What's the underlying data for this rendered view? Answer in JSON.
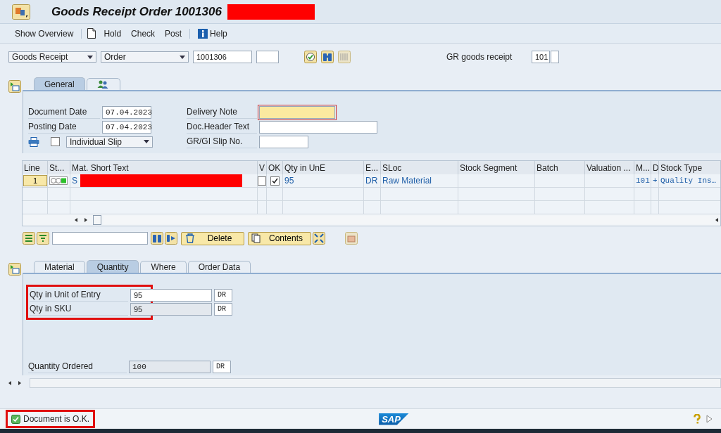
{
  "window": {
    "title": "Goods Receipt Order 1001306"
  },
  "toolbar": [
    {
      "kind": "text",
      "label": "Show Overview"
    },
    {
      "kind": "document"
    },
    {
      "kind": "text",
      "label": "Hold"
    },
    {
      "kind": "text",
      "label": "Check"
    },
    {
      "kind": "text",
      "label": "Post"
    },
    {
      "kind": "info",
      "label": "Help"
    }
  ],
  "selection": {
    "action": "Goods Receipt",
    "reference": "Order",
    "number": "1001306",
    "movement_label": "GR goods receipt",
    "movement_type": "101"
  },
  "header_tabs": [
    {
      "kind": "text",
      "label": "General",
      "selected": true
    },
    {
      "kind": "persons",
      "selected": false
    }
  ],
  "general": {
    "left_fields": [
      {
        "label": "Document Date",
        "value": "07.04.2023"
      },
      {
        "label": "Posting Date",
        "value": "07.04.2023"
      }
    ],
    "print_checked": false,
    "print_version": "Individual Slip",
    "right_fields": [
      {
        "label": "Delivery Note",
        "focused": true
      },
      {
        "label": "Doc.Header Text",
        "focused": false
      },
      {
        "label": "GR/GI Slip No.",
        "focused": false
      }
    ]
  },
  "table": {
    "columns": [
      "Line",
      "St...",
      "Mat. Short Text",
      "V",
      "OK",
      "Qty in UnE",
      "E...",
      "SLoc",
      "Stock Segment",
      "Batch",
      "Valuation ...",
      "M...",
      "D",
      "Stock Type"
    ],
    "rows": [
      {
        "line": "1",
        "mat_short_text": "S",
        "v_checked": false,
        "ok_checked": true,
        "qty": "95",
        "unit": "DR",
        "sloc": "Raw Material",
        "movement": "101",
        "d": "+",
        "stock_type": "Quality Ins…"
      }
    ]
  },
  "table_toolbar": {
    "delete": "Delete",
    "contents": "Contents"
  },
  "detail_tabs": [
    {
      "label": "Material",
      "selected": false
    },
    {
      "label": "Quantity",
      "selected": true
    },
    {
      "label": "Where",
      "selected": false
    },
    {
      "label": "Order Data",
      "selected": false
    }
  ],
  "quantity": {
    "highlighted": true,
    "fields": [
      {
        "label": "Qty in Unit of Entry",
        "value": "95",
        "unit": "DR",
        "editable": true
      },
      {
        "label": "Qty in SKU",
        "value": "95",
        "unit": "DR",
        "editable": false
      }
    ],
    "ordered": {
      "label": "Quantity Ordered",
      "value": "100",
      "unit": "DR",
      "editable": false
    }
  },
  "status_bar": {
    "message": "Document is O.K.",
    "highlighted": true,
    "logo": "SAP"
  }
}
